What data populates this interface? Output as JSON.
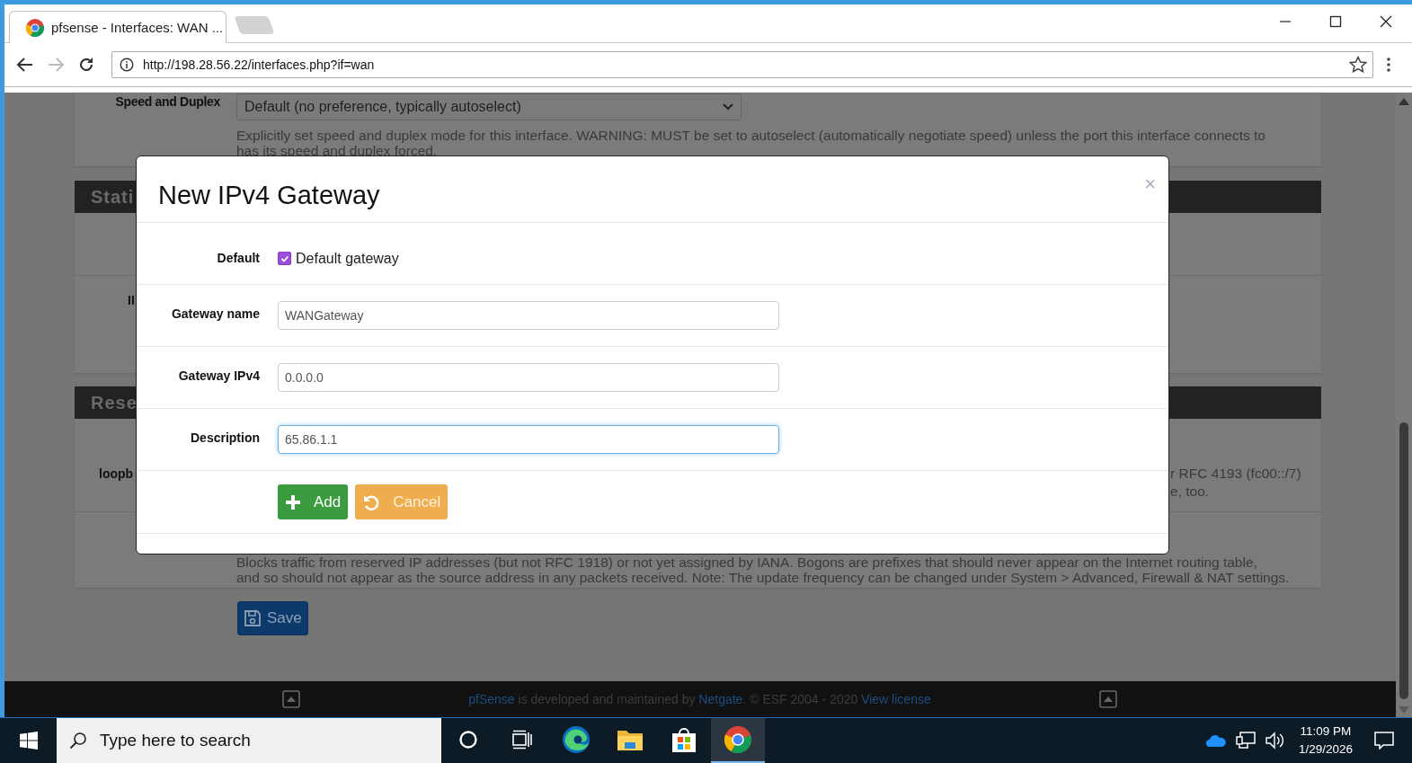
{
  "browser": {
    "tab_title": "pfsense - Interfaces: WAN ...",
    "url": "http://198.28.56.22/interfaces.php?if=wan"
  },
  "page": {
    "speed_duplex": {
      "label": "Speed and Duplex",
      "value": "Default (no preference, typically autoselect)",
      "help": [
        "Explicitly set speed and duplex mode for this interface. WARNING: MUST be set to autoselect (automatically negotiate speed) unless the port this interface connects to",
        "has its speed and duplex forced."
      ]
    },
    "static_heading": "Stati",
    "static_label": "II",
    "reserved_heading": "Rese",
    "reserved_rows": [
      {
        "label": "loopb",
        "help": [
          "r RFC 4193 (fc00::/7)",
          "e, too."
        ]
      },
      {
        "label": "",
        "help": [
          "Blocks traffic from reserved IP addresses (but not RFC 1918) or not yet assigned by IANA. Bogons are prefixes that should never appear on the Internet routing table,",
          "and so should not appear as the source address in any packets received. Note: The update frequency can be changed under System > Advanced, Firewall & NAT settings."
        ]
      }
    ],
    "save_button": "Save"
  },
  "footer": [
    {
      "kind": "link",
      "text": "pfSense"
    },
    {
      "kind": "text",
      "text": " is developed and maintained by "
    },
    {
      "kind": "link",
      "text": "Netgate"
    },
    {
      "kind": "text",
      "text": ". © ESF 2004 - 2020 "
    },
    {
      "kind": "link",
      "text": "View license"
    }
  ],
  "modal": {
    "title": "New IPv4 Gateway",
    "close": "×",
    "fields": [
      {
        "label": "Default",
        "kind": "checkbox",
        "text": "Default gateway",
        "checked": true
      },
      {
        "label": "Gateway name",
        "kind": "input",
        "value": "WANGateway",
        "focused": false
      },
      {
        "label": "Gateway IPv4",
        "kind": "input",
        "value": "0.0.0.0",
        "focused": false
      },
      {
        "label": "Description",
        "kind": "input",
        "value": "65.86.1.1",
        "focused": true
      }
    ],
    "buttons": [
      {
        "kind": "add",
        "label": "Add"
      },
      {
        "kind": "cancel",
        "label": "Cancel"
      }
    ]
  },
  "taskbar": {
    "search_placeholder": "Type here to search",
    "apps": [
      {
        "kind": "cortana",
        "selected": false
      },
      {
        "kind": "taskview",
        "selected": false
      },
      {
        "kind": "edge",
        "selected": false
      },
      {
        "kind": "explorer",
        "selected": false
      },
      {
        "kind": "store",
        "selected": false
      },
      {
        "kind": "chrome",
        "selected": true
      }
    ],
    "time": "11:09 PM",
    "date": "1/29/2026"
  }
}
